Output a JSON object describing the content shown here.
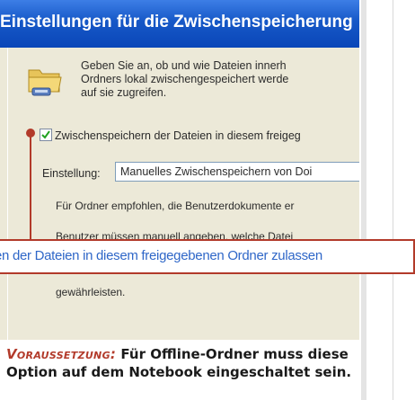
{
  "dialog": {
    "title": "Einstellungen für die Zwischenspeicherung",
    "description": "Geben Sie an, ob und wie Dateien innerh\nOrdners lokal zwischengespeichert werde\nauf sie zugreifen.",
    "checkbox_label": "Zwischenspeichern der Dateien in diesem freigeg",
    "checkbox_checked": true,
    "setting_label": "Einstellung:",
    "setting_value": "Manuelles Zwischenspeichern von Doi",
    "hint_1": "Für Ordner empfohlen, die Benutzerdokumente er",
    "hint_2": "Benutzer müssen manuell angeben, welche Datei",
    "hint_3": "gewährleisten."
  },
  "callout": {
    "text": "en der Dateien in diesem freigegebenen Ordner zulassen"
  },
  "caption": {
    "keyword": "Voraussetzung:",
    "text": " Für Offline-Ordner muss diese Option auf dem Notebook eingeschaltet sein."
  },
  "colors": {
    "accent_red": "#b23a2a",
    "title_blue": "#1658c7",
    "callout_blue": "#2f67c8",
    "dialog_bg": "#ece9d8"
  },
  "icons": {
    "folder": "folder-icon",
    "checkmark": "checkmark-icon"
  }
}
